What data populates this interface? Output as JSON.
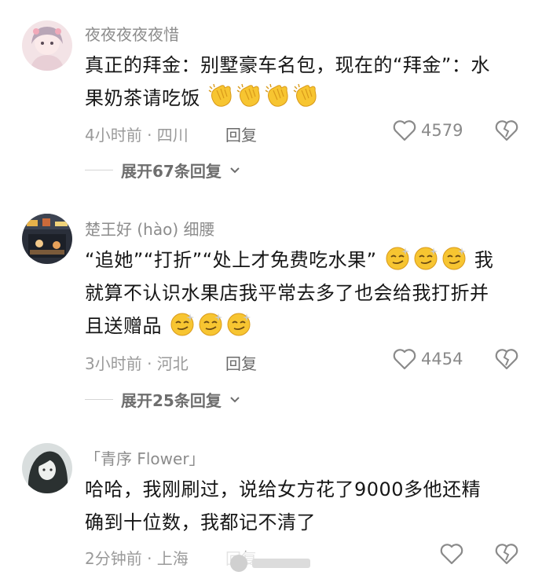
{
  "comments": [
    {
      "username": "夜夜夜夜夜惜",
      "text_lines": [
        "真正的拜金：别墅豪车名包，现在的“拜金”：水",
        "果奶茶请吃饭"
      ],
      "emoji": "clapping-hands",
      "emoji_count": 4,
      "time_location": "4小时前 · 四川",
      "reply_label": "回复",
      "likes": "4579",
      "expand_label": "展开67条回复"
    },
    {
      "username": "楚王好 (hào) 细腰",
      "text_lines": [
        "“追她”“打折”“处上才免费吃水果”",
        "就算不认识水果店我平常去多了也会给我打折并",
        "且送赠品"
      ],
      "line1_suffix": "我",
      "emoji": "smirk-face",
      "time_location": "3小时前 · 河北",
      "reply_label": "回复",
      "likes": "4454",
      "expand_label": "展开25条回复"
    },
    {
      "username": "「青序 Flower」",
      "text_lines": [
        "哈哈，我刚刷过，说给女方花了9000多他还精",
        "确到十位数，我都记不清了"
      ],
      "time_location": "2分钟前 · 上海",
      "reply_label": "回复",
      "likes": ""
    }
  ],
  "colors": {
    "emoji_yellow": "#f7c531",
    "secondary_text": "#8c8c8c"
  }
}
